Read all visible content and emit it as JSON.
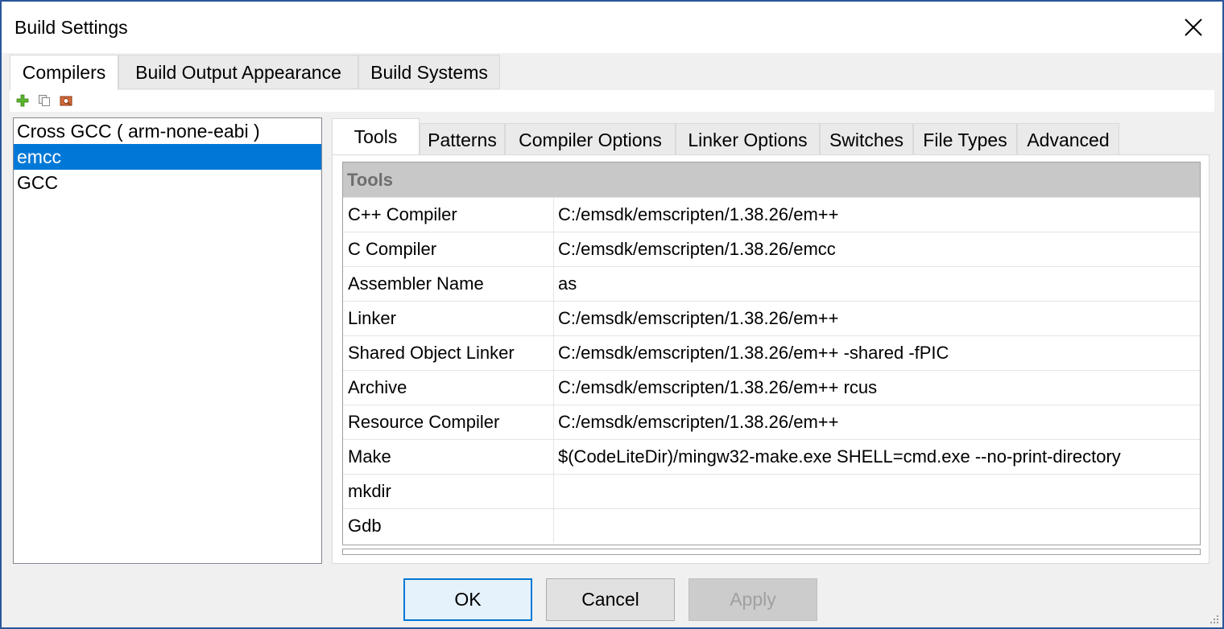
{
  "window": {
    "title": "Build Settings",
    "close_icon": "close-icon"
  },
  "top_tabs": [
    {
      "label": "Compilers",
      "active": true
    },
    {
      "label": "Build Output Appearance",
      "active": false
    },
    {
      "label": "Build Systems",
      "active": false
    }
  ],
  "toolbar": {
    "icons": [
      "add-icon",
      "copy-icon",
      "find-icon"
    ]
  },
  "compilers": [
    {
      "label": "Cross GCC ( arm-none-eabi )",
      "selected": false
    },
    {
      "label": "emcc",
      "selected": true
    },
    {
      "label": "GCC",
      "selected": false
    }
  ],
  "inner_tabs": [
    {
      "label": "Tools",
      "active": true
    },
    {
      "label": "Patterns",
      "active": false
    },
    {
      "label": "Compiler Options",
      "active": false
    },
    {
      "label": "Linker Options",
      "active": false
    },
    {
      "label": "Switches",
      "active": false
    },
    {
      "label": "File Types",
      "active": false
    },
    {
      "label": "Advanced",
      "active": false
    }
  ],
  "tools": {
    "category": "Tools",
    "rows": [
      {
        "name": "C++ Compiler",
        "value": "C:/emsdk/emscripten/1.38.26/em++"
      },
      {
        "name": "C Compiler",
        "value": "C:/emsdk/emscripten/1.38.26/emcc"
      },
      {
        "name": "Assembler Name",
        "value": "as"
      },
      {
        "name": "Linker",
        "value": "C:/emsdk/emscripten/1.38.26/em++"
      },
      {
        "name": "Shared Object Linker",
        "value": "C:/emsdk/emscripten/1.38.26/em++ -shared -fPIC"
      },
      {
        "name": "Archive",
        "value": "C:/emsdk/emscripten/1.38.26/em++ rcus"
      },
      {
        "name": "Resource Compiler",
        "value": "C:/emsdk/emscripten/1.38.26/em++"
      },
      {
        "name": "Make",
        "value": "$(CodeLiteDir)/mingw32-make.exe SHELL=cmd.exe  --no-print-directory"
      },
      {
        "name": "mkdir",
        "value": ""
      },
      {
        "name": "Gdb",
        "value": ""
      }
    ]
  },
  "buttons": {
    "ok": "OK",
    "cancel": "Cancel",
    "apply": "Apply"
  },
  "colors": {
    "accent": "#0078d7",
    "window_border": "#2b579a",
    "category_bg": "#c8c8c8"
  }
}
